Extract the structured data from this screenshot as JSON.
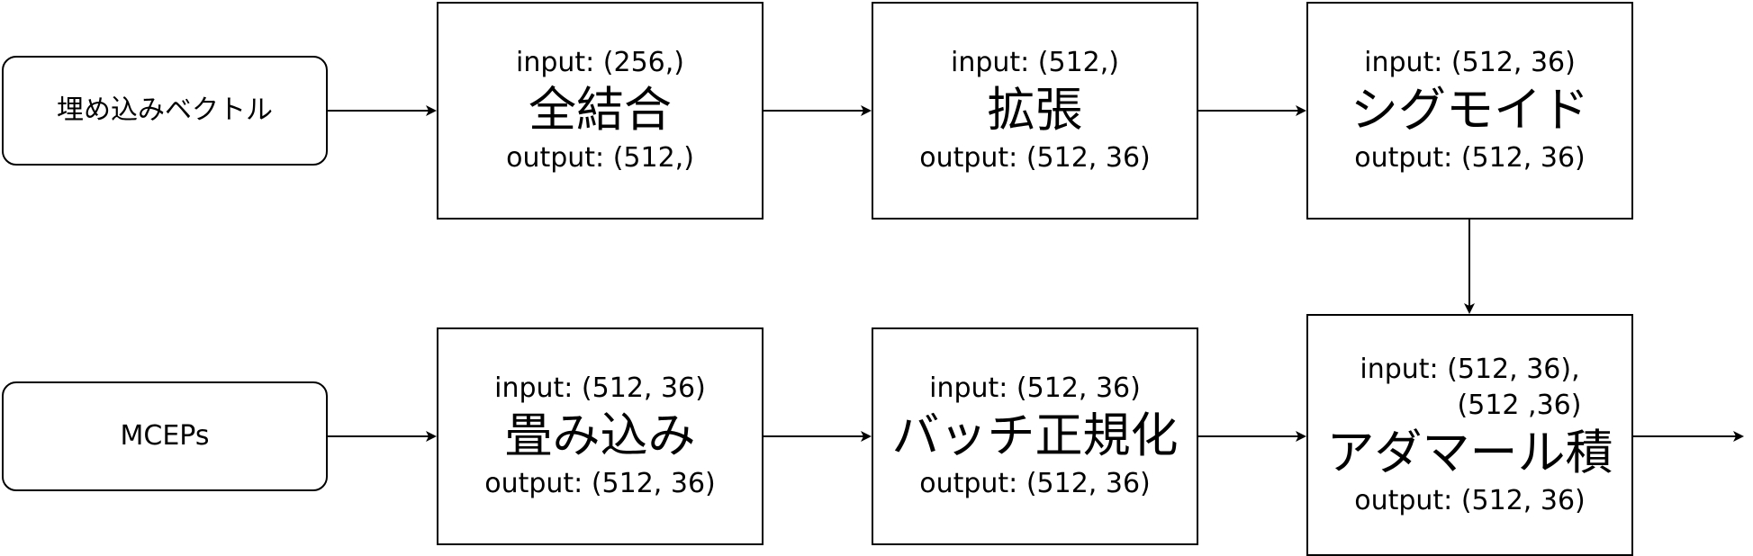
{
  "nodes": {
    "embedding": {
      "label": "埋め込みベクトル"
    },
    "mceps": {
      "label": "MCEPs"
    },
    "fully_connected": {
      "input": "input: (256,)",
      "title": "全結合",
      "output": "output: (512,)"
    },
    "expand": {
      "input": "input: (512,)",
      "title": "拡張",
      "output": "output: (512, 36)"
    },
    "sigmoid": {
      "input": "input: (512, 36)",
      "title": "シグモイド",
      "output": "output: (512, 36)"
    },
    "convolution": {
      "input": "input: (512, 36)",
      "title": "畳み込み",
      "output": "output: (512, 36)"
    },
    "batch_norm": {
      "input": "input: (512, 36)",
      "title": "バッチ正規化",
      "output": "output: (512, 36)"
    },
    "hadamard": {
      "input_line1": "input: (512, 36),",
      "input_line2": "(512 ,36)",
      "title": "アダマール積",
      "output": "output: (512, 36)"
    }
  },
  "colors": {
    "stroke": "#000000",
    "fill": "#ffffff",
    "text": "#000000"
  }
}
